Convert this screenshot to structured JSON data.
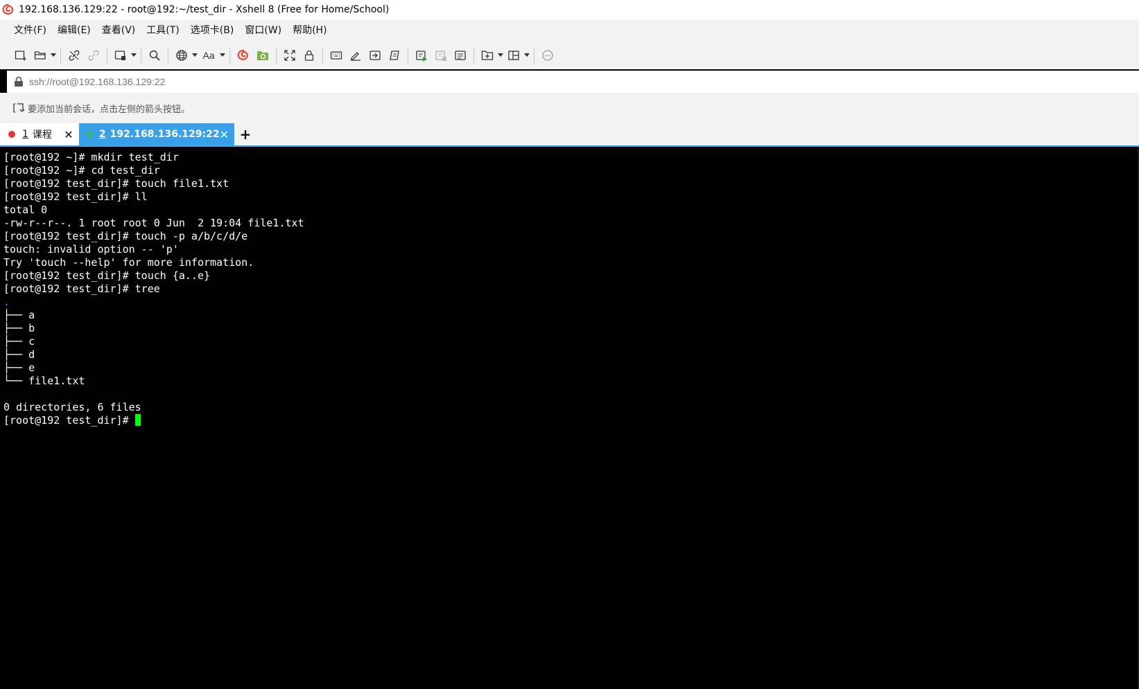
{
  "window": {
    "title": "192.168.136.129:22 - root@192:~/test_dir - Xshell 8 (Free for Home/School)"
  },
  "menu": [
    "文件(F)",
    "编辑(E)",
    "查看(V)",
    "工具(T)",
    "选项卡(B)",
    "窗口(W)",
    "帮助(H)"
  ],
  "toolbar": {
    "font_label": "Aa"
  },
  "address": {
    "value": "ssh://root@192.168.136.129:22"
  },
  "session_hint": "要添加当前会话，点击左侧的箭头按钮。",
  "tabs": [
    {
      "num": "1",
      "label": "课程",
      "status_color": "#e8333a",
      "active": false
    },
    {
      "num": "2",
      "label": "192.168.136.129:22",
      "status_color": "#22c55e",
      "active": true
    }
  ],
  "new_tab": "+",
  "terminal": {
    "lines": [
      "[root@192 ~]# mkdir test_dir",
      "[root@192 ~]# cd test_dir",
      "[root@192 test_dir]# touch file1.txt",
      "[root@192 test_dir]# ll",
      "total 0",
      "-rw-r--r--. 1 root root 0 Jun  2 19:04 file1.txt",
      "[root@192 test_dir]# touch -p a/b/c/d/e",
      "touch: invalid option -- 'p'",
      "Try 'touch --help' for more information.",
      "[root@192 test_dir]# touch {a..e}",
      "[root@192 test_dir]# tree",
      ".",
      "├── a",
      "├── b",
      "├── c",
      "├── d",
      "├── e",
      "└── file1.txt",
      "",
      "0 directories, 6 files"
    ],
    "prompt": "[root@192 test_dir]# ",
    "cursor_color": "#00ff00",
    "tree_root_color": "#3b8cff"
  },
  "colors": {
    "accent": "#3aa0e8",
    "chrome_bg": "#f3f3f3",
    "terminal_bg": "#000000"
  }
}
